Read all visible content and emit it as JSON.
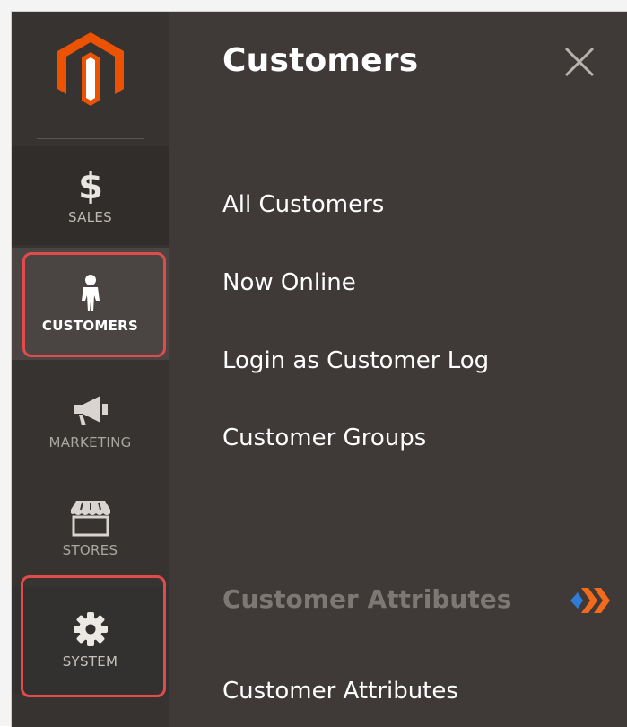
{
  "sidebar": {
    "logo_icon": "magento-logo",
    "items": [
      {
        "label": "SALES",
        "icon": "dollar-icon"
      },
      {
        "label": "CUSTOMERS",
        "icon": "person-icon"
      },
      {
        "label": "MARKETING",
        "icon": "megaphone-icon"
      },
      {
        "label": "STORES",
        "icon": "store-icon"
      },
      {
        "label": "SYSTEM",
        "icon": "gear-icon"
      }
    ]
  },
  "panel": {
    "title": "Customers",
    "close_icon": "close-icon",
    "links": [
      "All Customers",
      "Now Online",
      "Login as Customer Log",
      "Customer Groups"
    ],
    "section_heading": "Customer Attributes",
    "section_icon": "extension-badge-icon",
    "section_links": [
      "Customer Attributes"
    ]
  },
  "colors": {
    "sidebar_bg": "#373331",
    "panel_bg": "#3f3a38",
    "logo_orange": "#eb5202",
    "highlight_red": "#e14b4b",
    "section_heading": "#7d7874"
  }
}
